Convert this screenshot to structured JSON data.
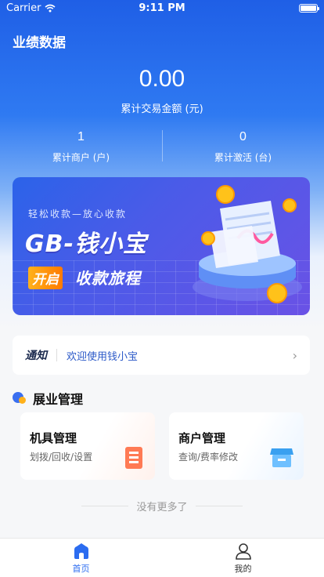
{
  "status_bar": {
    "carrier": "Carrier",
    "time": "9:11 PM"
  },
  "page": {
    "title": "业绩数据"
  },
  "summary": {
    "total_amount": "0.00",
    "total_amount_label": "累计交易金额 (元)",
    "merchants_count": "1",
    "merchants_label": "累计商户 (户)",
    "activations_count": "0",
    "activations_label": "累计激活 (台)"
  },
  "banner": {
    "subtitle": "轻松收款—放心收款",
    "main": "GB-钱小宝",
    "tag": "开启",
    "tagline": "收款旅程"
  },
  "notice": {
    "tag": "通知",
    "message": "欢迎使用钱小宝"
  },
  "section": {
    "title": "展业管理"
  },
  "cards": [
    {
      "title": "机具管理",
      "subtitle": "划拨/回收/设置",
      "icon": "device-icon"
    },
    {
      "title": "商户管理",
      "subtitle": "查询/费率修改",
      "icon": "shop-icon"
    }
  ],
  "footer": {
    "no_more": "没有更多了"
  },
  "tabbar": {
    "items": [
      {
        "label": "首页",
        "icon": "home-icon",
        "active": true
      },
      {
        "label": "我的",
        "icon": "user-icon",
        "active": false
      }
    ]
  },
  "colors": {
    "accent": "#2b6cf0",
    "orange": "#ff7a00"
  }
}
